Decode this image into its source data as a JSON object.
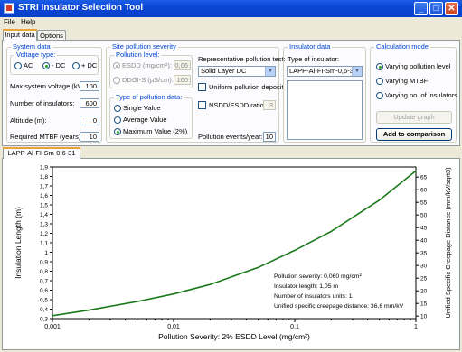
{
  "window": {
    "title": "STRI Insulator Selection Tool",
    "minimize": "_",
    "maximize": "□",
    "close": "✕"
  },
  "menu": {
    "file": "File",
    "help": "Help"
  },
  "tabs": {
    "input_data": "Input data",
    "options": "Options"
  },
  "system_data": {
    "title": "System data",
    "voltage_type": {
      "title": "Voltage type:",
      "ac": "AC",
      "minus_dc": "- DC",
      "plus_dc": "+ DC",
      "selected": "- DC"
    },
    "max_voltage_label": "Max system voltage (kV):",
    "max_voltage": "100",
    "num_insulators_label": "Number of insulators:",
    "num_insulators": "600",
    "altitude_label": "Altitude (m):",
    "altitude": "0",
    "mtbf_label": "Required MTBF (years):",
    "mtbf": "10"
  },
  "site_pollution": {
    "title": "Site pollution severity",
    "pollution_level": {
      "title": "Pollution level:",
      "esdd_label": "ESDD (mg/cm²):",
      "esdd": "0,06",
      "ddgis_label": "DDGI-S (µS/cm):",
      "ddgis": "100"
    },
    "type_of_data": {
      "title": "Type of pollution data:",
      "single": "Single Value",
      "average": "Average Value",
      "maximum": "Maximum Value (2%)",
      "selected": "Maximum Value (2%)"
    },
    "rep_test_label": "Representative pollution test:",
    "rep_test_value": "Solid Layer DC",
    "uniform_label": "Uniform pollution deposit",
    "nsdd_label": "NSDD/ESDD ratio:",
    "nsdd": "3",
    "events_label": "Pollution events/year:",
    "events": "10"
  },
  "insulator_data": {
    "title": "Insulator data",
    "type_label": "Type of insulator:",
    "type_value": "LAPP-Al-FI-Sm-0,6-31"
  },
  "calc_mode": {
    "title": "Calculation mode",
    "varying_pollution": "Varying pollution level",
    "varying_mtbf": "Varying MTBF",
    "varying_insulators": "Varying no. of insulators",
    "selected": "Varying pollution level",
    "update_graph": "Update graph",
    "add_comparison": "Add to comparison"
  },
  "chart_tab": "LAPP-Al-FI-Sm-0,6-31",
  "chart_data": {
    "type": "line",
    "xlabel": "Pollution Severity: 2% ESDD Level (mg/cm²)",
    "ylabel": "Insulation Length (m)",
    "ylabel_right": "Unified Specific Creepage Distance (mm/kV/sqrt3)",
    "x_scale": "log",
    "xlim": [
      0.001,
      1
    ],
    "ylim": [
      0.3,
      1.9
    ],
    "y2lim": [
      9,
      69
    ],
    "x_ticks": [
      "0,001",
      "0,01",
      "0,1",
      "1"
    ],
    "y_ticks": [
      "0,3",
      "0,4",
      "0,5",
      "0,6",
      "0,7",
      "0,8",
      "0,9",
      "1",
      "1,1",
      "1,2",
      "1,3",
      "1,4",
      "1,5",
      "1,6",
      "1,7",
      "1,8",
      "1,9"
    ],
    "y2_ticks": [
      "10",
      "15",
      "20",
      "25",
      "30",
      "35",
      "40",
      "45",
      "50",
      "55",
      "60",
      "65"
    ],
    "series": [
      {
        "color": "#1a7a1a",
        "x": [
          0.001,
          0.002,
          0.005,
          0.01,
          0.02,
          0.05,
          0.1,
          0.2,
          0.5,
          1
        ],
        "y": [
          0.33,
          0.39,
          0.48,
          0.56,
          0.66,
          0.84,
          1.02,
          1.22,
          1.55,
          1.86
        ]
      }
    ],
    "annotations": [
      "Pollution severity: 0,060 mg/cm²",
      "Insulator length: 1,05 m",
      "Number of insulators units: 1",
      "Unified specific creepage distance: 36,6 mm/kV"
    ],
    "grid": false
  }
}
